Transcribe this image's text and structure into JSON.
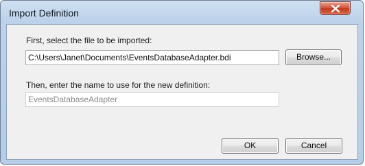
{
  "window": {
    "title": "Import Definition"
  },
  "file_section": {
    "label": "First, select the file to be imported:",
    "path_value": "C:\\Users\\Janet\\Documents\\EventsDatabaseAdapter.bdi",
    "browse_label": "Browse..."
  },
  "name_section": {
    "label": "Then, enter the name to use for the new definition:",
    "name_value": "EventsDatabaseAdapter"
  },
  "buttons": {
    "ok_label": "OK",
    "cancel_label": "Cancel"
  },
  "colors": {
    "titlebar": "#bcd2ea",
    "client": "#f0f0f0",
    "close_button": "#c0391f"
  }
}
